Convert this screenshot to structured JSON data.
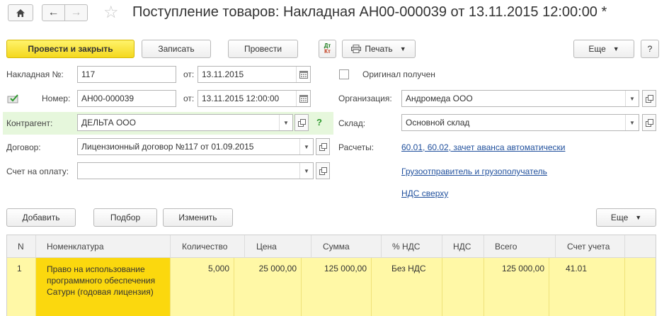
{
  "window": {
    "title": "Поступление товаров: Накладная АН00-000039 от 13.11.2015 12:00:00 *"
  },
  "toolbar": {
    "post_close": "Провести и закрыть",
    "save": "Записать",
    "post": "Провести",
    "dtkt_top": "Дт",
    "dtkt_bottom": "Кт",
    "print": "Печать",
    "more": "Еще",
    "help": "?"
  },
  "form": {
    "invoice_label": "Накладная №:",
    "invoice_no": "117",
    "from_label_1": "от:",
    "invoice_date": "13.11.2015",
    "number_label": "Номер:",
    "number": "АН00-000039",
    "from_label_2": "от:",
    "number_datetime": "13.11.2015 12:00:00",
    "original_label": "Оригинал получен",
    "original_checked": false,
    "org_label": "Организация:",
    "org": "Андромеда ООО",
    "counterparty_label": "Контрагент:",
    "counterparty": "ДЕЛЬТА ООО",
    "counterparty_help": "?",
    "warehouse_label": "Склад:",
    "warehouse": "Основной склад",
    "contract_label": "Договор:",
    "contract": "Лицензионный договор №117 от 01.09.2015",
    "settlements_label": "Расчеты:",
    "settlements_link": "60.01, 60.02, зачет аванса автоматически",
    "pay_invoice_label": "Счет на оплату:",
    "pay_invoice": "",
    "shipper_link": "Грузоотправитель и грузополучатель",
    "vat_link": "НДС сверху"
  },
  "table_toolbar": {
    "add": "Добавить",
    "select": "Подбор",
    "change": "Изменить",
    "more": "Еще"
  },
  "table": {
    "columns": [
      "N",
      "Номенклатура",
      "Количество",
      "Цена",
      "Сумма",
      "% НДС",
      "НДС",
      "Всего",
      "Счет учета"
    ],
    "rows": [
      {
        "n": "1",
        "item": "Право на использование программного обеспечения Сатурн (годовая лицензия)",
        "qty": "5,000",
        "price": "25 000,00",
        "sum": "125 000,00",
        "vat_rate": "Без НДС",
        "vat": "",
        "total": "125 000,00",
        "account": "41.01"
      }
    ]
  },
  "colors": {
    "accent_yellow": "#f4d81e",
    "selected_cell": "#fbd80e",
    "row_highlight": "#fff8a6",
    "counterparty_bg": "#e6f7dc",
    "link": "#1f4f9c"
  }
}
